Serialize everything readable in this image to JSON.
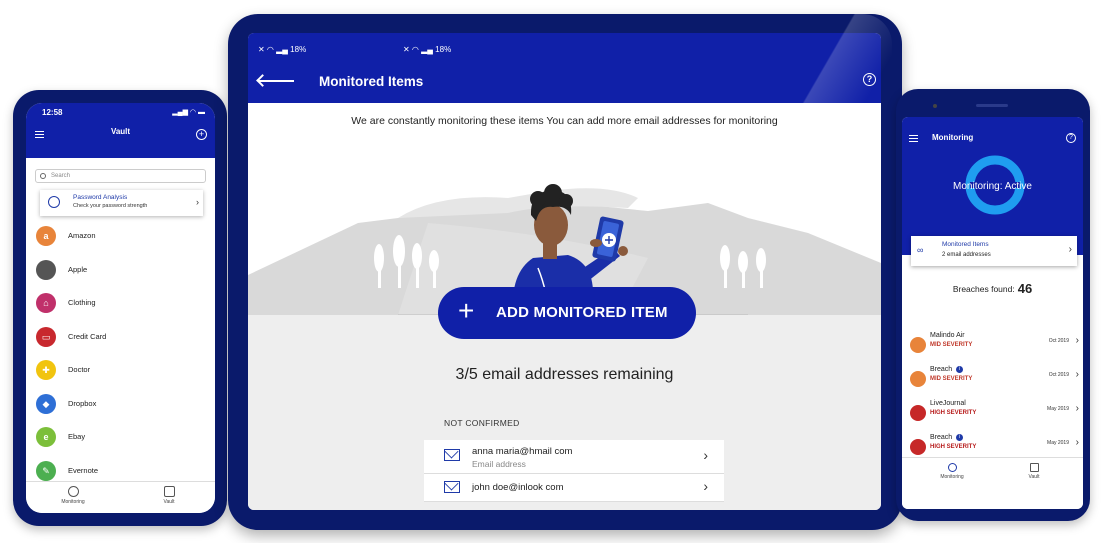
{
  "left_phone": {
    "status_time": "12:58",
    "title": "Vault",
    "search_placeholder": "Search",
    "analysis": {
      "title": "Password Analysis",
      "subtitle": "Check your password strength"
    },
    "items": [
      {
        "label": "Amazon",
        "color": "#e8843a",
        "glyph": "a"
      },
      {
        "label": "Apple",
        "color": "#555555",
        "glyph": ""
      },
      {
        "label": "Clothing",
        "color": "#c0306a",
        "glyph": "⌂"
      },
      {
        "label": "Credit Card",
        "color": "#c8282e",
        "glyph": "▭"
      },
      {
        "label": "Doctor",
        "color": "#f1c40f",
        "glyph": "✚"
      },
      {
        "label": "Dropbox",
        "color": "#2e6fd6",
        "glyph": "◆"
      },
      {
        "label": "Ebay",
        "color": "#7cbf3a",
        "glyph": "e"
      },
      {
        "label": "Evernote",
        "color": "#4caf50",
        "glyph": "✎"
      }
    ],
    "tabs": {
      "monitoring": "Monitoring",
      "vault": "Vault"
    }
  },
  "tablet": {
    "status_left": "18%",
    "status_mid": "18%",
    "title": "Monitored Items",
    "intro": "We are constantly monitoring these items  You can add more email addresses for monitoring",
    "add_button": "ADD MONITORED ITEM",
    "remaining": "3/5 email addresses remaining",
    "section_label": "NOT CONFIRMED",
    "rows": [
      {
        "value": "anna maria@hmail com",
        "sub": "Email address"
      },
      {
        "value": "john doe@inlook com",
        "sub": ""
      }
    ]
  },
  "right_phone": {
    "title": "Monitoring",
    "status": "Monitoring: Active",
    "card": {
      "title": "Monitored Items",
      "subtitle": "2 email addresses"
    },
    "breaches_label": "Breaches found:",
    "breaches_count": "46",
    "breaches": [
      {
        "name": "Malindo Air",
        "severity": "MID SEVERITY",
        "date": "Oct 2019",
        "color": "#e8843a",
        "sev_color": "#c0392b",
        "info": false
      },
      {
        "name": "Breach",
        "severity": "MID SEVERITY",
        "date": "Oct 2019",
        "color": "#e8843a",
        "sev_color": "#c0392b",
        "info": true
      },
      {
        "name": "LiveJournal",
        "severity": "HIGH SEVERITY",
        "date": "May 2019",
        "color": "#c62828",
        "sev_color": "#b71c1c",
        "info": false
      },
      {
        "name": "Breach",
        "severity": "HIGH SEVERITY",
        "date": "May 2019",
        "color": "#c62828",
        "sev_color": "#b71c1c",
        "info": true
      }
    ],
    "tabs": {
      "monitoring": "Monitoring",
      "vault": "Vault"
    }
  },
  "colors": {
    "brand_blue": "#1020a8",
    "device_frame": "#0a1a6b",
    "accent_blue": "#1f3aa8"
  }
}
